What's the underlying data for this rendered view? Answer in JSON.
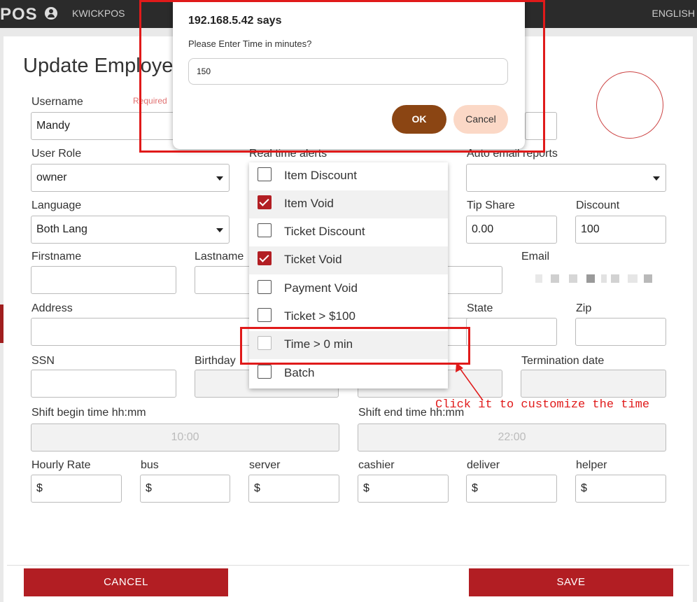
{
  "topbar": {
    "brand": "POS",
    "store_name": "KWICKPOS",
    "language": "ENGLISH"
  },
  "page": {
    "title": "Update Employe"
  },
  "form": {
    "username": {
      "label": "Username",
      "required": "Required",
      "value": "Mandy"
    },
    "user_role": {
      "label": "User Role",
      "value": "owner"
    },
    "real_time_alerts": {
      "label": "Real time alerts"
    },
    "auto_email_reports": {
      "label": "Auto email reports",
      "value": ""
    },
    "language": {
      "label": "Language",
      "value": "Both Lang"
    },
    "tip_share": {
      "label": "Tip Share",
      "value": "0.00"
    },
    "discount": {
      "label": "Discount",
      "value": "100"
    },
    "firstname": {
      "label": "Firstname",
      "value": ""
    },
    "lastname": {
      "label": "Lastname",
      "value": ""
    },
    "email": {
      "label": "Email"
    },
    "address": {
      "label": "Address",
      "value": ""
    },
    "state": {
      "label": "State",
      "value": ""
    },
    "zip": {
      "label": "Zip",
      "value": ""
    },
    "ssn": {
      "label": "SSN",
      "value": ""
    },
    "birthday": {
      "label": "Birthday",
      "value": ""
    },
    "termination_date": {
      "label": "Termination date",
      "value": ""
    },
    "shift_begin": {
      "label": "Shift begin time hh:mm",
      "value": "10:00"
    },
    "shift_end": {
      "label": "Shift end time hh:mm",
      "value": "22:00"
    },
    "rates": [
      {
        "label": "Hourly Rate",
        "value": "$"
      },
      {
        "label": "bus",
        "value": "$"
      },
      {
        "label": "server",
        "value": "$"
      },
      {
        "label": "cashier",
        "value": "$"
      },
      {
        "label": "deliver",
        "value": "$"
      },
      {
        "label": "helper",
        "value": "$"
      }
    ]
  },
  "alerts_dropdown": {
    "options": [
      {
        "label": "Item Discount",
        "checked": false
      },
      {
        "label": "Item Void",
        "checked": true
      },
      {
        "label": "Ticket Discount",
        "checked": false
      },
      {
        "label": "Ticket Void",
        "checked": true
      },
      {
        "label": "Payment Void",
        "checked": false
      },
      {
        "label": "Ticket > $100",
        "checked": false
      },
      {
        "label": "Time > 0 min",
        "checked": false
      },
      {
        "label": "Batch",
        "checked": false
      }
    ]
  },
  "dialog": {
    "title": "192.168.5.42 says",
    "message": "Please Enter Time in minutes?",
    "input_value": "150",
    "ok_label": "OK",
    "cancel_label": "Cancel"
  },
  "annotation": {
    "text": "Click it to customize the time",
    "color": "#e01a1a"
  },
  "buttons": {
    "cancel": "CANCEL",
    "save": "SAVE"
  },
  "colors": {
    "accent": "#b21e23",
    "ok_button": "#8b4513",
    "cancel_button": "#fbd8c6"
  }
}
